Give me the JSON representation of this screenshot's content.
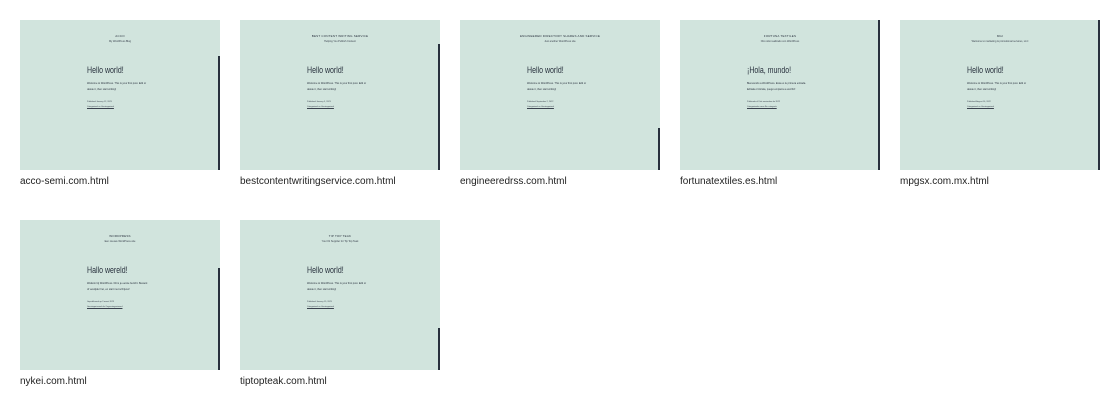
{
  "files": [
    {
      "filename": "acco-semi.com.html",
      "site_title": "ACCO",
      "tagline": "My WordPress Blog",
      "heading": "Hello world!",
      "body": "Welcome to WordPress. This is your first post. Edit or delete it, then start writing!",
      "meta_line1": "Published January 12, 2023",
      "meta_line2": "Categorized as Uncategorized"
    },
    {
      "filename": "bestcontentwritingservice.com.html",
      "site_title": "BEST CONTENT WRITING SERVICE",
      "tagline": "Helping You Publish Content",
      "heading": "Hello world!",
      "body": "Welcome to WordPress. This is your first post. Edit or delete it, then start writing!",
      "meta_line1": "Published January 5, 2023",
      "meta_line2": "Categorized as Uncategorized"
    },
    {
      "filename": "engineeredrss.com.html",
      "site_title": "ENGINEERED DIRECTORY SHARES AND SERVICE",
      "tagline": "Just another WordPress site",
      "heading": "Hello world!",
      "body": "Welcome to WordPress. This is your first post. Edit or delete it, then start writing!",
      "meta_line1": "Published September 2, 2022",
      "meta_line2": "Categorized as Uncategorized"
    },
    {
      "filename": "fortunatextiles.es.html",
      "site_title": "FORTUNA TEXTILES",
      "tagline": "Otro sitio realizado con WordPress",
      "heading": "¡Hola, mundo!",
      "body": "Bienvenido a WordPress. Esta es tu primera entrada. Edítala o bórrala, ¡luego empieza a escribir!",
      "meta_line1": "Publicada el 8 de noviembre de 2022",
      "meta_line2": "Categorizado como Sin categoría"
    },
    {
      "filename": "mpgsx.com.mx.html",
      "site_title": "MGI",
      "tagline": "Welcome to marketing & promotional services, LLC",
      "heading": "Hello world!",
      "body": "Welcome to WordPress. This is your first post. Edit or delete it, then start writing!",
      "meta_line1": "Published August 16, 2022",
      "meta_line2": "Categorized as Uncategorized"
    },
    {
      "filename": "nykei.com.html",
      "site_title": "WORDPRESS",
      "tagline": "Een nieuwe WordPress-site",
      "heading": "Hallo wereld!",
      "body": "Welkom bij WordPress. Dit is je eerste bericht. Bewerk of verwijder het, en start met schrijven!",
      "meta_line1": "Gepubliceerd op 3 maart 2023",
      "meta_line2": "Gecategoriseerd als Ongecategoriseerd"
    },
    {
      "filename": "tiptopteak.com.html",
      "site_title": "TIP TOP TEAK",
      "tagline": "Your #1 Supplier for Tip Top Teak",
      "heading": "Hello world!",
      "body": "Welcome to WordPress. This is your first post. Edit or delete it, then start writing!",
      "meta_line1": "Published January 19, 2023",
      "meta_line2": "Categorized as Uncategorized"
    }
  ]
}
